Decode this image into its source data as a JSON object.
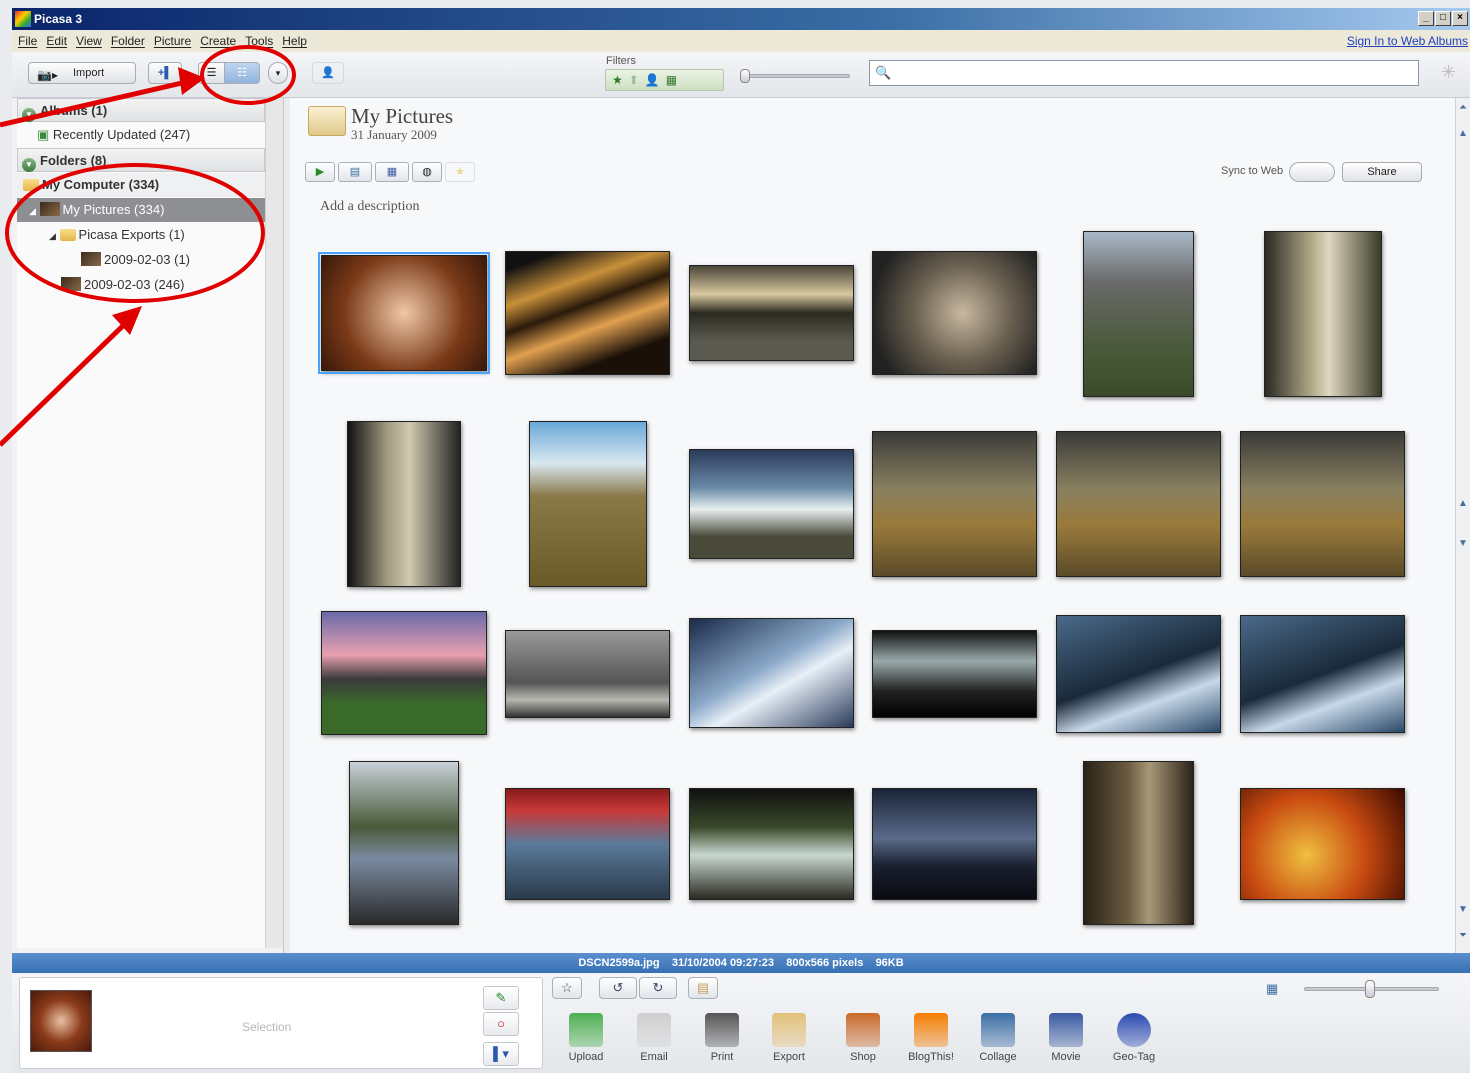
{
  "window": {
    "title": "Picasa 3",
    "controls": [
      "_",
      "□",
      "×"
    ]
  },
  "menu": {
    "items": [
      "File",
      "Edit",
      "View",
      "Folder",
      "Picture",
      "Create",
      "Tools",
      "Help"
    ],
    "sign_in": "Sign In to Web Albums"
  },
  "toolbar": {
    "import_label": "Import",
    "filters_label": "Filters"
  },
  "sidebar": {
    "albums_header": "Albums (1)",
    "recently_updated": "Recently Updated (247)",
    "folders_header": "Folders (8)",
    "my_computer": "My Computer (334)",
    "my_pictures": "My Pictures (334)",
    "picasa_exports": "Picasa Exports (1)",
    "export_date": "2009-02-03 (1)",
    "folder_date": "2009-02-03 (246)"
  },
  "folder": {
    "title": "My Pictures",
    "date": "31 January 2009",
    "description_placeholder": "Add a description",
    "sync_label": "Sync to Web",
    "share_label": "Share"
  },
  "status": {
    "filename": "DSCN2599a.jpg",
    "datetime": "31/10/2004 09:27:23",
    "dimensions": "800x566 pixels",
    "size": "96KB"
  },
  "tray": {
    "selection_label": "Selection",
    "tools": [
      {
        "label": "Upload",
        "color": "#4caf50"
      },
      {
        "label": "Email",
        "color": "#cfcfcf"
      },
      {
        "label": "Print",
        "color": "#555555"
      },
      {
        "label": "Export",
        "color": "#e2c07a"
      },
      {
        "label": "Shop",
        "color": "#c96a2a"
      },
      {
        "label": "BlogThis!",
        "color": "#f57d00"
      },
      {
        "label": "Collage",
        "color": "#3a6ea5"
      },
      {
        "label": "Movie",
        "color": "#3a5aa0"
      },
      {
        "label": "Geo-Tag",
        "color": "#2a4ab0"
      }
    ]
  },
  "photos": [
    {
      "label": "photo-spiderweb",
      "g": "radial-gradient(circle at 50% 50%,#f0c8a8,#7a3a18 60%,#3a1808)",
      "selected": true
    },
    {
      "label": "photo-wave-sculpture",
      "g": "linear-gradient(160deg,#111 10%,#c8903a 30%,#2a1a0a 45%,#e0a050 60%,#1a1008 80%)"
    },
    {
      "label": "photo-lake-sunset",
      "g": "linear-gradient(#4a4538 0%,#d8c8a0 30%,#2a2a20 50%,#5a5a50 80%)"
    },
    {
      "label": "photo-fish",
      "g": "radial-gradient(circle at 55% 50%,#c8b8a0,#6a6050 45%,#222 85%)"
    },
    {
      "label": "photo-church-path",
      "g": "linear-gradient(#a8b8c8 0%,#6a6a6a 30%,#4a5a3a 70%,#3a4a2a)"
    },
    {
      "label": "photo-waterfall-figure",
      "g": "linear-gradient(90deg,#2a2a22,#b0a888 40%,#e0d8c0 55%,#3a3a2a)"
    },
    {
      "label": "photo-waterfall-night",
      "g": "linear-gradient(90deg,#111,#a09a80 35%,#d0c8b0 55%,#222)"
    },
    {
      "label": "photo-river-plain",
      "g": "linear-gradient(#6aa8d8 0%,#d8e8f0 25%,#8a7a4a 45%,#6a5a2a 100%)"
    },
    {
      "label": "photo-waterfall-cliffs",
      "g": "linear-gradient(#2a3a5a 0%,#6a8aa8 35%,#e8f0f0 55%,#4a4a3a 80%)"
    },
    {
      "label": "photo-road-tree-1",
      "g": "linear-gradient(#3a3a38 0%,#8a8060 40%,#9a7a3a 65%,#5a4a2a)"
    },
    {
      "label": "photo-road-tree-2",
      "g": "linear-gradient(#3a3a38 0%,#8a8060 40%,#9a7a3a 65%,#5a4a2a)"
    },
    {
      "label": "photo-road-tree-3",
      "g": "linear-gradient(#3a3a38 0%,#8a8060 40%,#9a7a3a 65%,#5a4a2a)"
    },
    {
      "label": "photo-stadium",
      "g": "linear-gradient(#6a6aa8 0%,#e8a0b0 35%,#3a3a3a 55%,#3a6a2a 75%)"
    },
    {
      "label": "photo-horse-rider",
      "g": "linear-gradient(#9a9a9a 0%,#555 60%,#b8b8b0 80%,#333)"
    },
    {
      "label": "photo-glacier",
      "g": "linear-gradient(150deg,#1a2a4a,#8aa8c8 45%,#e8f0f8 60%,#2a3a5a)"
    },
    {
      "label": "photo-silhouettes",
      "g": "linear-gradient(#111 0%,#9aa 35%,#222 70%,#000)"
    },
    {
      "label": "photo-sailor-1",
      "g": "linear-gradient(160deg,#4a6a8a,#1a2a3a 50%,#c8d8e8 70%,#2a4a6a)"
    },
    {
      "label": "photo-sailor-2",
      "g": "linear-gradient(160deg,#4a6a8a,#1a2a3a 50%,#c8d8e8 70%,#2a4a6a)"
    },
    {
      "label": "photo-valley-lake",
      "g": "linear-gradient(#c8d0d8 0%,#4a5a3a 40%,#7a8aa0 60%,#2a2a2a)"
    },
    {
      "label": "photo-boat-water",
      "g": "linear-gradient(#8a1a1a 0%,#c83a3a 20%,#5a7a9a 50%,#2a3a4a)"
    },
    {
      "label": "photo-weir",
      "g": "linear-gradient(#111 0%,#3a4a2a 35%,#c8d8d0 60%,#2a2a22)"
    },
    {
      "label": "photo-dusk-clouds",
      "g": "linear-gradient(#1a2438 0%,#5a6a8a 45%,#1a2030 70%,#0a0a10)"
    },
    {
      "label": "photo-street",
      "g": "linear-gradient(90deg,#2a2218,#6a5a40 40%,#a89878 60%,#2a2218)"
    },
    {
      "label": "photo-leaf",
      "g": "radial-gradient(circle at 40% 60%,#f0c040,#c84a10 50%,#3a0a00)"
    }
  ]
}
